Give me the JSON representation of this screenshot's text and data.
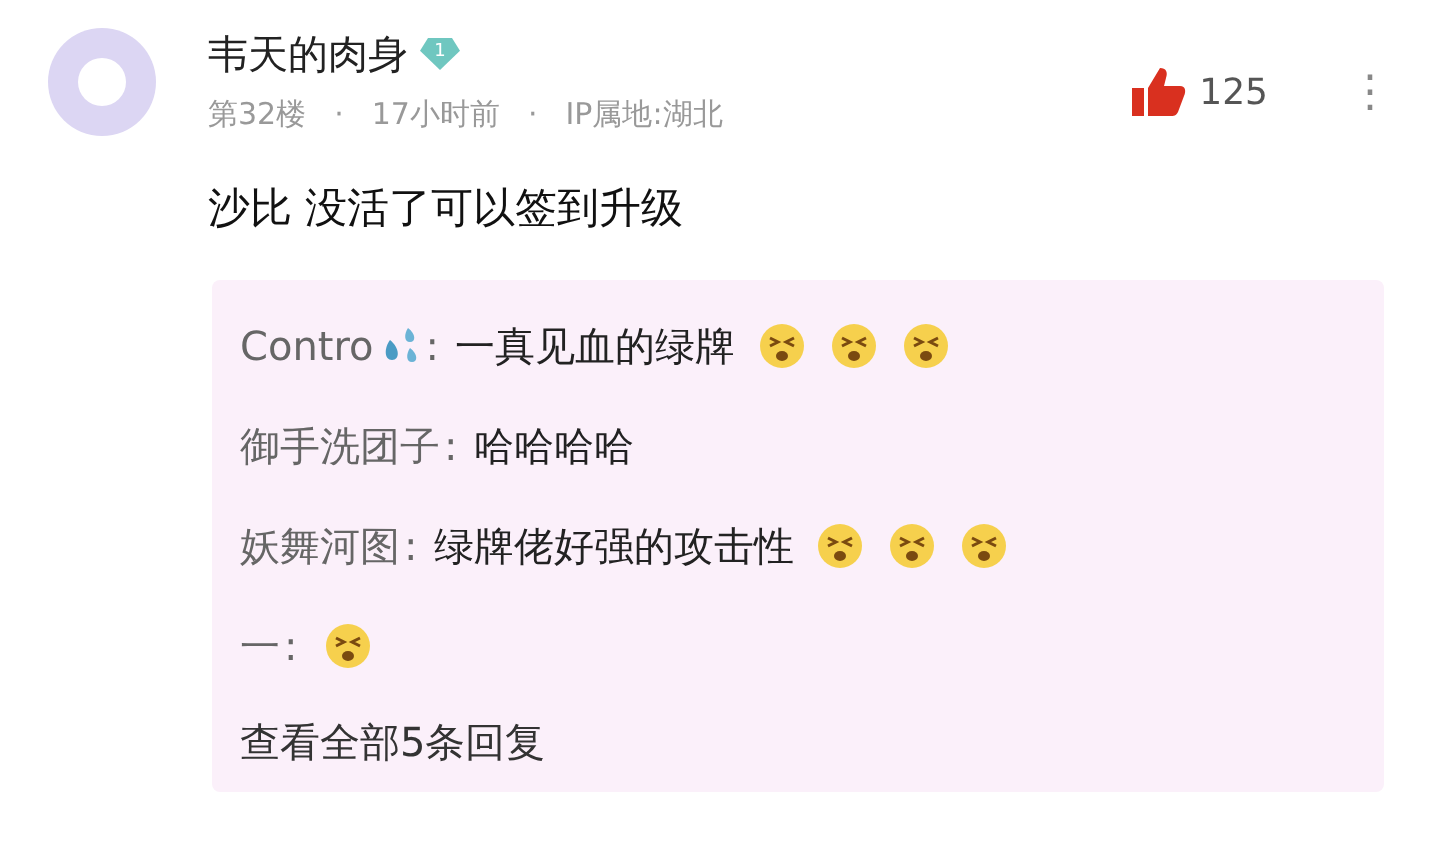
{
  "post": {
    "author": "韦天的肉身",
    "level_badge": "1",
    "meta": [
      "第32楼",
      "·",
      "17小时前",
      "·",
      "IP属地:湖北"
    ],
    "likes": "125",
    "more": "⋮",
    "content": "沙比 没活了可以签到升级"
  },
  "replies": [
    {
      "author": "Contro",
      "author_icon": {
        "kind": "droplets"
      },
      "sep": ":",
      "text": "一真见血的绿牌",
      "emojis": [
        {
          "kind": "laugh"
        },
        {
          "kind": "laugh"
        },
        {
          "kind": "laugh"
        }
      ]
    },
    {
      "author": "御手洗团子",
      "sep": ":",
      "text": "哈哈哈哈"
    },
    {
      "author": "妖舞河图",
      "sep": ":",
      "text": "绿牌佬好强的攻击性",
      "emojis": [
        {
          "kind": "laugh"
        },
        {
          "kind": "laugh"
        },
        {
          "kind": "laugh"
        }
      ]
    },
    {
      "author": "一",
      "sep": ":",
      "emojis": [
        {
          "kind": "laugh"
        }
      ]
    }
  ],
  "view_all": "查看全部5条回复"
}
